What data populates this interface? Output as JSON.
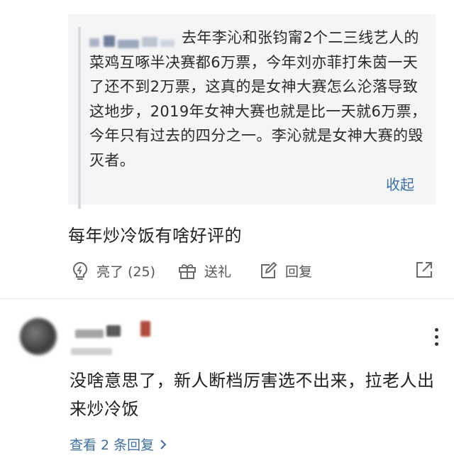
{
  "quoted_comment": {
    "text": "去年李沁和张钧甯2个二三线艺人的菜鸡互啄半决赛都6万票，今年刘亦菲打朱茵一天了还不到2万票，这真的是女神大赛怎么沦落导致这地步，2019年女神大赛也就是比一天就6万票，今年只有过去的四分之一。李沁就是女神大赛的毁灭者。",
    "collapse_label": "收起"
  },
  "main_comment": {
    "text": "每年炒冷饭有啥好评的"
  },
  "actions": {
    "like_label": "亮了 (25)",
    "gift_label": "送礼",
    "reply_label": "回复"
  },
  "reply_comment": {
    "text": "没啥意思了，新人断档厉害选不出来，拉老人出来炒冷饭",
    "view_replies_label": "查看 2 条回复"
  },
  "colors": {
    "link": "#3e6ea6",
    "quote_background": "#f4f5f7"
  }
}
